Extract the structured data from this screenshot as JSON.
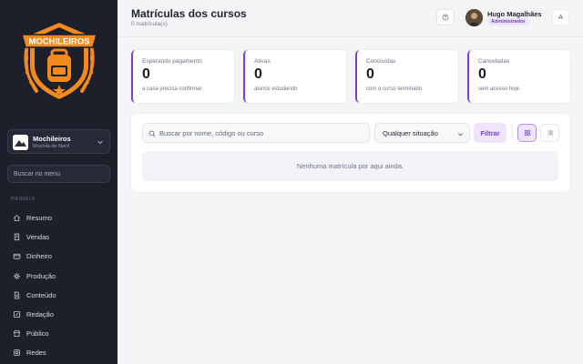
{
  "sidebar": {
    "logo_text": "MOCHILEIROS",
    "org": {
      "name": "Mochileiros",
      "subtitle": "Mochila de Nerd"
    },
    "search_placeholder": "Buscar no menu",
    "section_label": "PAINÉIS",
    "items": [
      {
        "label": "Resumo",
        "icon": "home-icon"
      },
      {
        "label": "Vendas",
        "icon": "receipt-icon"
      },
      {
        "label": "Dinheiro",
        "icon": "wallet-icon"
      },
      {
        "label": "Produção",
        "icon": "sparkle-icon"
      },
      {
        "label": "Conteúdo",
        "icon": "document-icon"
      },
      {
        "label": "Redação",
        "icon": "pencil-square-icon"
      },
      {
        "label": "Público",
        "icon": "storefront-icon"
      },
      {
        "label": "Redes",
        "icon": "instagram-icon"
      }
    ]
  },
  "header": {
    "title": "Matrículas dos cursos",
    "count": "0 matrícula(s)",
    "help_icon": "help-circle-icon",
    "user": {
      "name": "Hugo Magalhães",
      "role": "Administrador",
      "initial": "A"
    }
  },
  "stats": [
    {
      "label": "Esperando pagamento",
      "value": "0",
      "desc": "a casa precisa confirmar"
    },
    {
      "label": "Ativas",
      "value": "0",
      "desc": "alunos estudando"
    },
    {
      "label": "Concluídas",
      "value": "0",
      "desc": "com o curso terminado"
    },
    {
      "label": "Canceladas",
      "value": "0",
      "desc": "sem acesso hoje"
    }
  ],
  "filters": {
    "search_placeholder": "Buscar por nome, código ou curso",
    "search_value": "",
    "status_selected": "Qualquer situação",
    "filter_label": "Filtrar"
  },
  "empty_message": "Nenhuma matrícula por aqui ainda.",
  "colors": {
    "accent": "#7a3fd0",
    "accent_soft": "#efe4fb",
    "sidebar_bg": "#1d1f2b",
    "logo_orange": "#f28a1e",
    "page_bg": "#f4f5f7"
  }
}
